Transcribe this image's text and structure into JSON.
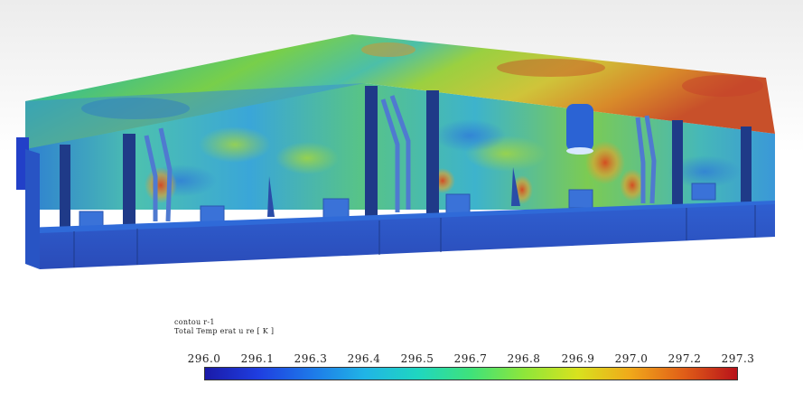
{
  "legend": {
    "name": "contou r-1",
    "quantity": "Total Temp erat u re [ K ]",
    "ticks": [
      "296.0",
      "296.1",
      "296.3",
      "296.4",
      "296.5",
      "296.7",
      "296.8",
      "296.9",
      "297.0",
      "297.2",
      "297.3"
    ],
    "colormap": [
      "#1a1aa8",
      "#1f3ee0",
      "#1e78e8",
      "#20b4e6",
      "#1fd6c0",
      "#3fe27a",
      "#8ee63a",
      "#d8e21e",
      "#f0a81a",
      "#e05e18",
      "#b8121a"
    ]
  },
  "scene_colors": {
    "cold_base": "#2f55c8",
    "cold_dark": "#1c3a9a",
    "mid": "#3fb7c8",
    "warm": "#8ad04a",
    "hot": "#d8461e"
  }
}
